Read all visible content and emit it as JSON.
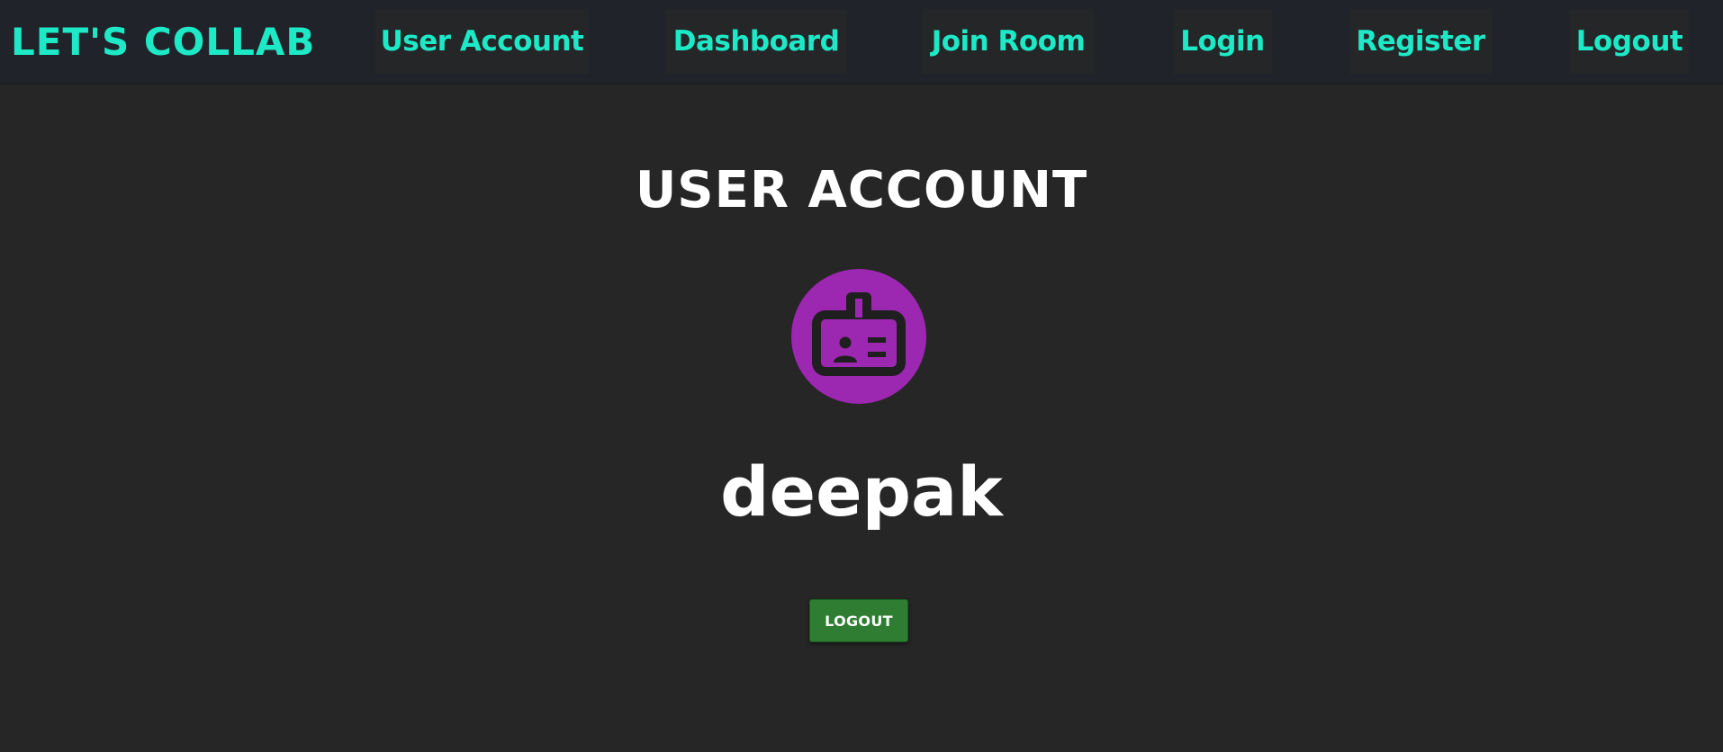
{
  "navbar": {
    "brand": "LET'S COLLAB",
    "items": [
      {
        "label": "User Account"
      },
      {
        "label": "Dashboard"
      },
      {
        "label": "Join Room"
      },
      {
        "label": "Login"
      },
      {
        "label": "Register"
      },
      {
        "label": "Logout"
      }
    ]
  },
  "main": {
    "title": "USER ACCOUNT",
    "avatar_icon": "badge-icon",
    "username": "deepak",
    "logout_label": "LOGOUT"
  },
  "colors": {
    "accent": "#1de9c7",
    "background": "#262626",
    "navbar_bg": "#20242a",
    "avatar_bg": "#9c27b0",
    "button_bg": "#2e7d32"
  }
}
